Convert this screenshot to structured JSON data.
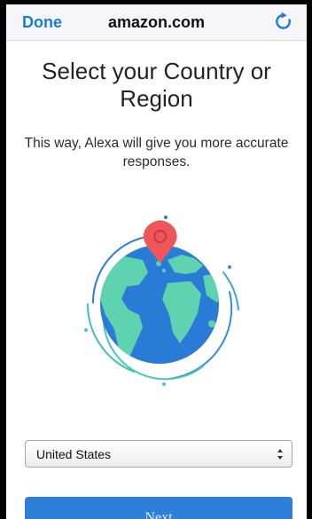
{
  "navbar": {
    "done_label": "Done",
    "title": "amazon.com",
    "reload_icon": "reload-icon"
  },
  "content": {
    "heading": "Select your Country or Region",
    "subtext": "This way, Alexa will give you more accurate responses.",
    "illustration_icon": "globe-location-pin-icon"
  },
  "country_select": {
    "selected": "United States"
  },
  "next_button": {
    "label": "Next"
  },
  "colors": {
    "accent": "#1a7ae0",
    "button": "#2e7fd8",
    "globe_ocean": "#2a7bd6",
    "globe_land": "#5fd3b0",
    "pin": "#f0555a"
  }
}
